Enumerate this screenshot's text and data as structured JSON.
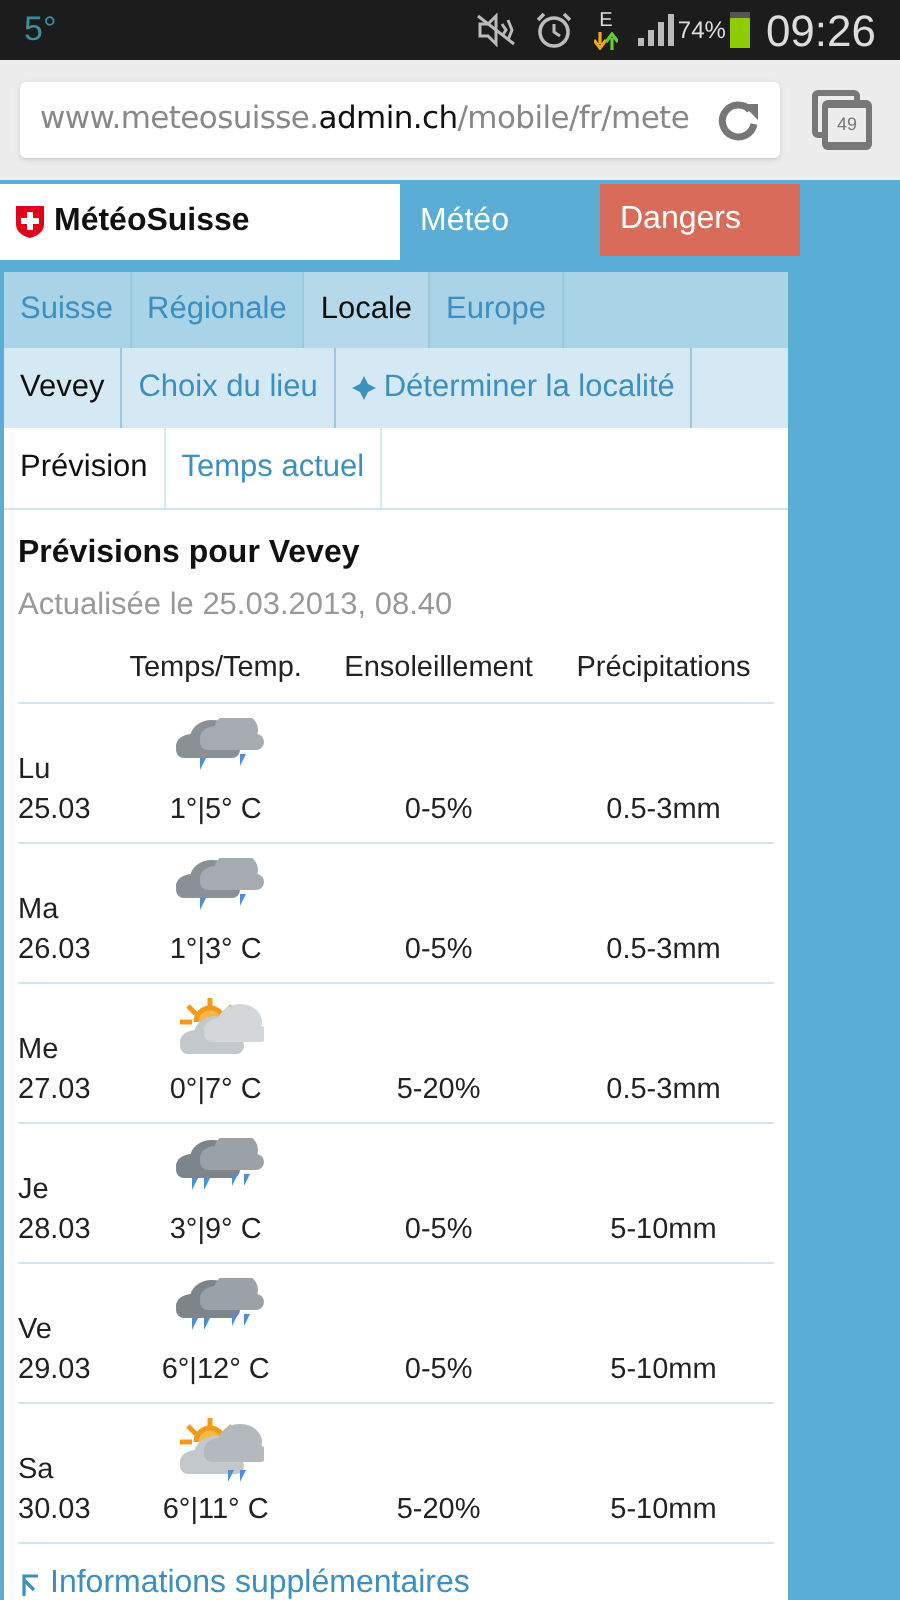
{
  "status_bar": {
    "temperature": "5°",
    "network": "E",
    "battery_percent": "74%",
    "time": "09:26"
  },
  "browser": {
    "url_parts": [
      {
        "text": "www.meteosuisse.",
        "kind": "muted"
      },
      {
        "text": "admin.ch",
        "kind": "host"
      },
      {
        "text": "/mobile/fr/mete",
        "kind": "muted"
      }
    ],
    "tab_count": "49"
  },
  "header": {
    "logo": "MétéoSuisse",
    "tabs": [
      {
        "label": "Météo",
        "kind": "meteo"
      },
      {
        "label": "Dangers",
        "kind": "dangers"
      }
    ]
  },
  "nav_tabs": [
    {
      "label": "Suisse",
      "selected": false
    },
    {
      "label": "Régionale",
      "selected": false
    },
    {
      "label": "Locale",
      "selected": true
    },
    {
      "label": "Europe",
      "selected": false
    }
  ],
  "location_tabs": [
    {
      "label": "Vevey",
      "selected": true,
      "kind": "plain"
    },
    {
      "label": "Choix du lieu",
      "selected": false,
      "kind": "plain"
    },
    {
      "label": "Déterminer la localité",
      "selected": false,
      "kind": "locate"
    }
  ],
  "view_tabs": [
    {
      "label": "Prévision",
      "selected": true
    },
    {
      "label": "Temps actuel",
      "selected": false
    }
  ],
  "forecast": {
    "title": "Prévisions pour Vevey",
    "updated": "Actualisée le 25.03.2013, 08.40",
    "columns": [
      "Temps/Temp.",
      "Ensoleillement",
      "Précipitations"
    ],
    "rows": [
      {
        "day": "Lu",
        "date": "25.03",
        "kind": "rain",
        "temp": "1°|5° C",
        "sun": "0-5%",
        "precip": "0.5-3mm"
      },
      {
        "day": "Ma",
        "date": "26.03",
        "kind": "rain",
        "temp": "1°|3° C",
        "sun": "0-5%",
        "precip": "0.5-3mm"
      },
      {
        "day": "Me",
        "date": "27.03",
        "kind": "sun_cloud",
        "temp": "0°|7° C",
        "sun": "5-20%",
        "precip": "0.5-3mm"
      },
      {
        "day": "Je",
        "date": "28.03",
        "kind": "heavy_rain",
        "temp": "3°|9° C",
        "sun": "0-5%",
        "precip": "5-10mm"
      },
      {
        "day": "Ve",
        "date": "29.03",
        "kind": "heavy_rain",
        "temp": "6°|12° C",
        "sun": "0-5%",
        "precip": "5-10mm"
      },
      {
        "day": "Sa",
        "date": "30.03",
        "kind": "sun_rain",
        "temp": "6°|11° C",
        "sun": "5-20%",
        "precip": "5-10mm"
      }
    ]
  },
  "more_link": "Informations supplémentaires"
}
